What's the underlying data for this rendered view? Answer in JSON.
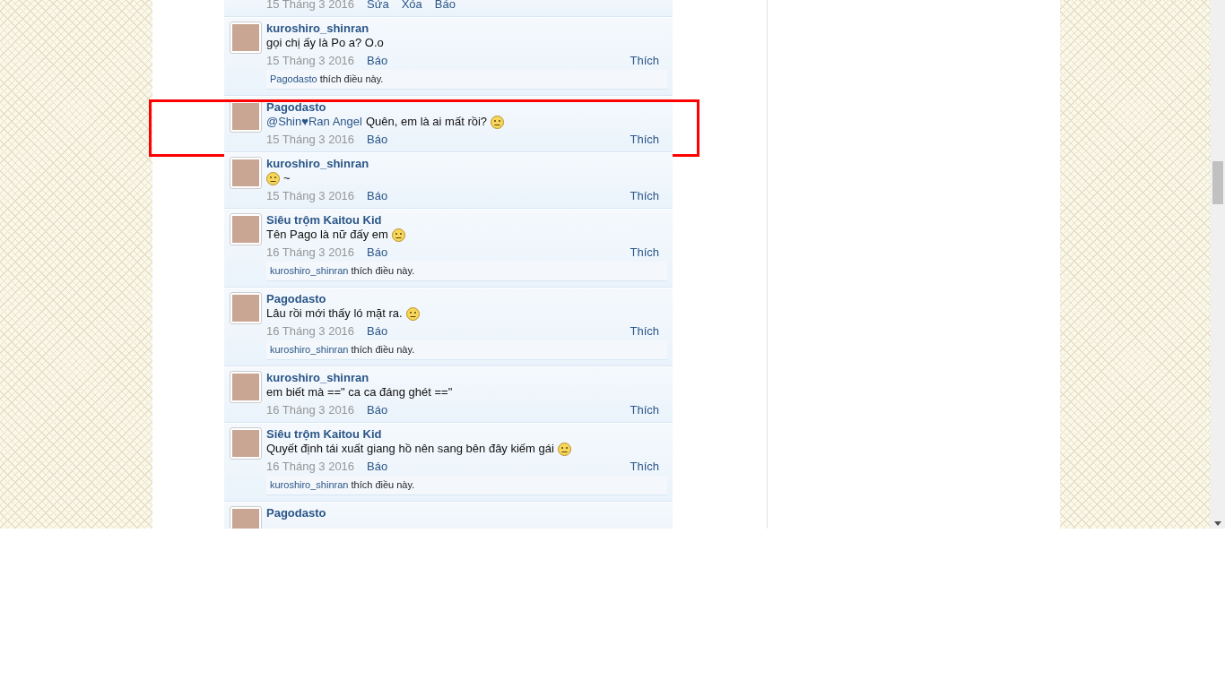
{
  "partial_comment": {
    "date": "15 Tháng 3 2016",
    "actions": [
      "Sửa",
      "Xóa",
      "Báo"
    ]
  },
  "comments": [
    {
      "author": "kuroshiro_shinran",
      "content": [
        {
          "kind": "text",
          "text": "gọi chị ấy là Po a? O.o"
        }
      ],
      "date": "15 Tháng 3 2016",
      "report": "Báo",
      "like": "Thích",
      "likes": {
        "user": "Pagodasto",
        "text": "thích điều này."
      },
      "highlighted": false
    },
    {
      "author": "Pagodasto",
      "content": [
        {
          "kind": "mention",
          "text": "@Shin♥Ran Angel"
        },
        {
          "kind": "text",
          "text": "Quên, em là ai mất rồi?"
        },
        {
          "kind": "smiley"
        }
      ],
      "date": "15 Tháng 3 2016",
      "report": "Báo",
      "like": "Thích",
      "highlighted": true
    },
    {
      "author": "kuroshiro_shinran",
      "content": [
        {
          "kind": "smiley"
        },
        {
          "kind": "text",
          "text": "~"
        }
      ],
      "date": "15 Tháng 3 2016",
      "report": "Báo",
      "like": "Thích",
      "highlighted": false
    },
    {
      "author": "Siêu trộm Kaitou Kid",
      "content": [
        {
          "kind": "text",
          "text": "Tên Pago là nữ đấy em"
        },
        {
          "kind": "smiley"
        }
      ],
      "date": "16 Tháng 3 2016",
      "report": "Báo",
      "like": "Thích",
      "likes": {
        "user": "kuroshiro_shinran",
        "text": "thích điều này."
      },
      "highlighted": false
    },
    {
      "author": "Pagodasto",
      "content": [
        {
          "kind": "text",
          "text": "Lâu rồi mới thấy ló mặt ra."
        },
        {
          "kind": "smiley"
        }
      ],
      "date": "16 Tháng 3 2016",
      "report": "Báo",
      "like": "Thích",
      "likes": {
        "user": "kuroshiro_shinran",
        "text": "thích điều này."
      },
      "highlighted": false
    },
    {
      "author": "kuroshiro_shinran",
      "content": [
        {
          "kind": "text",
          "text": "em biết mà ==\" ca ca đáng ghét ==\""
        }
      ],
      "date": "16 Tháng 3 2016",
      "report": "Báo",
      "like": "Thích",
      "highlighted": false
    },
    {
      "author": "Siêu trộm Kaitou Kid",
      "content": [
        {
          "kind": "text",
          "text": "Quyết định tái xuất giang hồ nên sang bên đây kiếm gái"
        },
        {
          "kind": "smiley"
        }
      ],
      "date": "16 Tháng 3 2016",
      "report": "Báo",
      "like": "Thích",
      "likes": {
        "user": "kuroshiro_shinran",
        "text": "thích điều này."
      },
      "highlighted": false
    },
    {
      "author": "Pagodasto",
      "highlighted": false
    }
  ]
}
